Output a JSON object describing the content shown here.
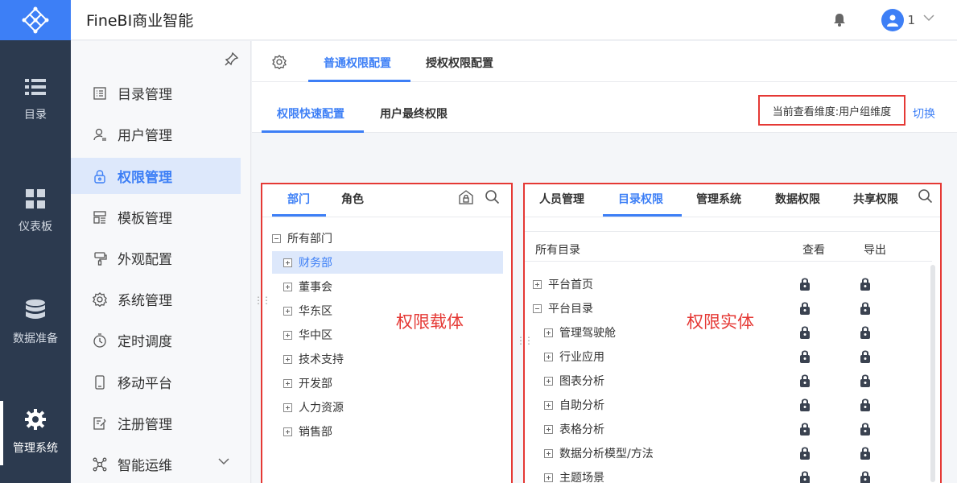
{
  "app": {
    "title": "FineBI商业智能",
    "user": "1"
  },
  "rail": [
    {
      "key": "catalog",
      "label": "目录",
      "icon": "list-icon"
    },
    {
      "key": "dashboard",
      "label": "仪表板",
      "icon": "dashboard-icon"
    },
    {
      "key": "data",
      "label": "数据准备",
      "icon": "database-icon"
    },
    {
      "key": "system",
      "label": "管理系统",
      "icon": "gear-icon",
      "active": true
    }
  ],
  "menu": {
    "items": [
      {
        "label": "目录管理",
        "icon": "catalog-icon"
      },
      {
        "label": "用户管理",
        "icon": "user-icon"
      },
      {
        "label": "权限管理",
        "icon": "lock-icon",
        "active": true
      },
      {
        "label": "模板管理",
        "icon": "template-icon"
      },
      {
        "label": "外观配置",
        "icon": "brush-icon"
      },
      {
        "label": "系统管理",
        "icon": "settings-icon"
      },
      {
        "label": "定时调度",
        "icon": "timer-icon"
      },
      {
        "label": "移动平台",
        "icon": "mobile-icon"
      },
      {
        "label": "注册管理",
        "icon": "register-icon"
      },
      {
        "label": "智能运维",
        "icon": "ops-icon"
      }
    ]
  },
  "main_tabs": {
    "normal": "普通权限配置",
    "grant": "授权权限配置"
  },
  "sub_tabs": {
    "quick": "权限快速配置",
    "final": "用户最终权限"
  },
  "dimension": {
    "label": "当前查看维度:用户组维度",
    "switch": "切换"
  },
  "left_panel": {
    "tabs": {
      "dept": "部门",
      "role": "角色"
    },
    "root": "所有部门",
    "nodes": [
      "财务部",
      "董事会",
      "华东区",
      "华中区",
      "技术支持",
      "开发部",
      "人力资源",
      "销售部"
    ],
    "selected_index": 0,
    "overlay": "权限载体"
  },
  "right_panel": {
    "tabs": [
      "人员管理",
      "目录权限",
      "管理系统",
      "数据权限",
      "共享权限"
    ],
    "active_tab_index": 1,
    "columns": {
      "name": "所有目录",
      "view": "查看",
      "export": "导出"
    },
    "rows": [
      {
        "label": "平台首页",
        "level": 0,
        "toggle": "plus"
      },
      {
        "label": "平台目录",
        "level": 0,
        "toggle": "minus"
      },
      {
        "label": "管理驾驶舱",
        "level": 1,
        "toggle": "plus"
      },
      {
        "label": "行业应用",
        "level": 1,
        "toggle": "plus"
      },
      {
        "label": "图表分析",
        "level": 1,
        "toggle": "plus"
      },
      {
        "label": "自助分析",
        "level": 1,
        "toggle": "plus"
      },
      {
        "label": "表格分析",
        "level": 1,
        "toggle": "plus"
      },
      {
        "label": "数据分析模型/方法",
        "level": 1,
        "toggle": "plus"
      },
      {
        "label": "主题场景",
        "level": 1,
        "toggle": "plus"
      }
    ],
    "overlay": "权限实体"
  },
  "colors": {
    "accent": "#3d7ff6",
    "rail": "#2c3a4f",
    "highlight": "#e53935"
  }
}
